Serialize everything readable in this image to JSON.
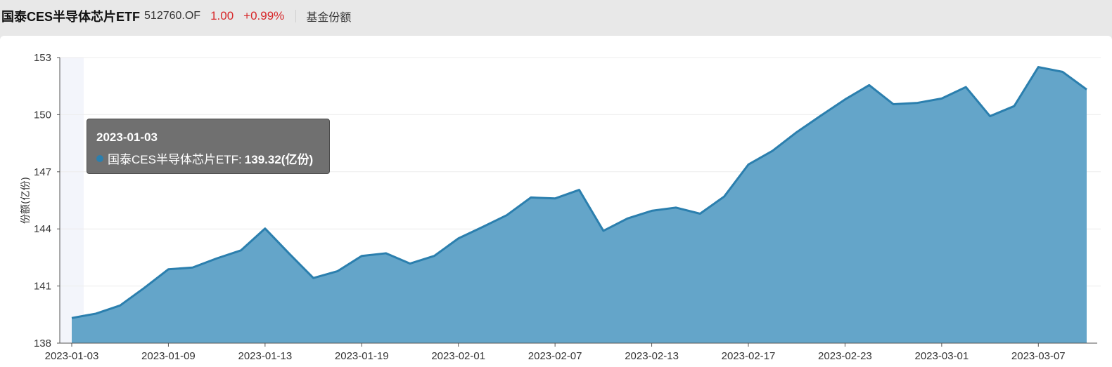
{
  "header": {
    "fund_name": "国泰CES半导体芯片ETF",
    "code": "512760.OF",
    "price": "1.00",
    "change": "+0.99%",
    "metric": "基金份额"
  },
  "tooltip": {
    "date": "2023-01-03",
    "series_label": "国泰CES半导体芯片ETF:",
    "value_text": "139.32(亿份)"
  },
  "colors": {
    "line": "#2b7fae",
    "area": "#64a5c9",
    "highlight_band": "#f3f5fb",
    "up": "#d7282a"
  },
  "chart_data": {
    "type": "area",
    "ylabel": "份额(亿份)",
    "ylim": [
      138,
      153
    ],
    "yticks": [
      138,
      141,
      144,
      147,
      150,
      153
    ],
    "x_tick_labels": [
      "2023-01-03",
      "2023-01-09",
      "2023-01-13",
      "2023-01-19",
      "2023-02-01",
      "2023-02-07",
      "2023-02-13",
      "2023-02-17",
      "2023-02-23",
      "2023-03-01",
      "2023-03-07"
    ],
    "grid": true,
    "highlighted_index": 0,
    "series": [
      {
        "name": "国泰CES半导体芯片ETF",
        "x": [
          "2023-01-03",
          "2023-01-04",
          "2023-01-05",
          "2023-01-06",
          "2023-01-09",
          "2023-01-10",
          "2023-01-11",
          "2023-01-12",
          "2023-01-13",
          "2023-01-16",
          "2023-01-17",
          "2023-01-18",
          "2023-01-19",
          "2023-01-20",
          "2023-01-30",
          "2023-01-31",
          "2023-02-01",
          "2023-02-02",
          "2023-02-03",
          "2023-02-06",
          "2023-02-07",
          "2023-02-08",
          "2023-02-09",
          "2023-02-10",
          "2023-02-13",
          "2023-02-14",
          "2023-02-15",
          "2023-02-16",
          "2023-02-17",
          "2023-02-20",
          "2023-02-21",
          "2023-02-22",
          "2023-02-23",
          "2023-02-24",
          "2023-02-27",
          "2023-02-28",
          "2023-03-01",
          "2023-03-02",
          "2023-03-03",
          "2023-03-06",
          "2023-03-07",
          "2023-03-08",
          "2023-03-09"
        ],
        "values": [
          139.32,
          139.55,
          139.98,
          140.9,
          141.88,
          141.97,
          142.45,
          142.87,
          144.02,
          142.7,
          141.42,
          141.78,
          142.58,
          142.72,
          142.18,
          142.58,
          143.5,
          144.1,
          144.72,
          145.65,
          145.6,
          146.05,
          143.9,
          144.55,
          144.95,
          145.12,
          144.8,
          145.7,
          147.38,
          148.1,
          149.08,
          149.95,
          150.8,
          151.55,
          150.55,
          150.62,
          150.85,
          151.45,
          149.92,
          150.45,
          152.5,
          152.25,
          151.32
        ]
      }
    ]
  }
}
